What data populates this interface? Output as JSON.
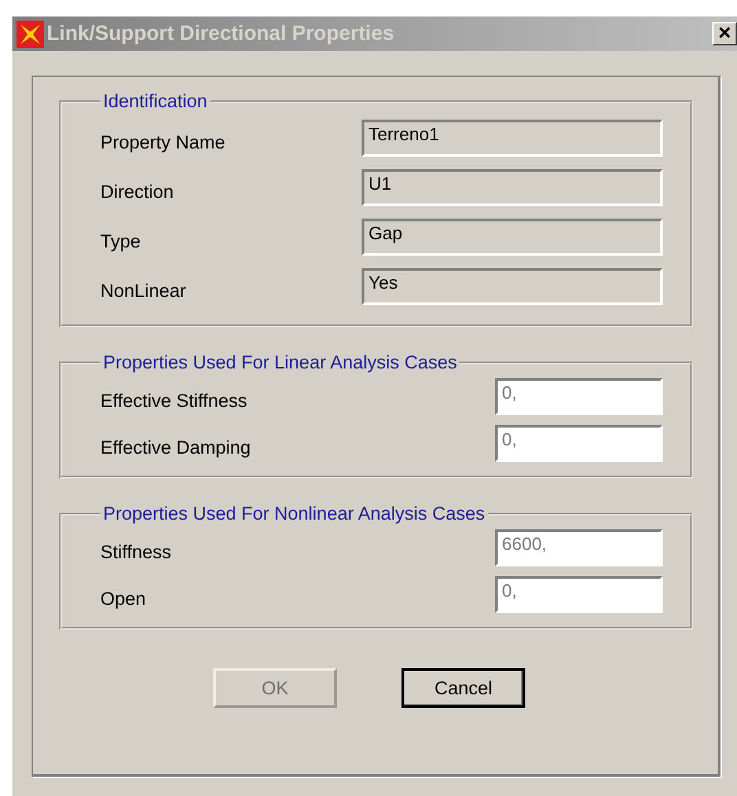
{
  "window": {
    "title": "Link/Support Directional Properties",
    "close": "×"
  },
  "groups": [
    {
      "title": "Identification",
      "kind": "identification",
      "fields": [
        {
          "label": "Property Name",
          "value": "Terreno1",
          "kind": "display",
          "disabled": false
        },
        {
          "label": "Direction",
          "value": "U1",
          "kind": "display",
          "disabled": false
        },
        {
          "label": "Type",
          "value": "Gap",
          "kind": "display",
          "disabled": false
        },
        {
          "label": "NonLinear",
          "value": "Yes",
          "kind": "display",
          "disabled": false
        }
      ]
    },
    {
      "title": "Properties Used For Linear Analysis Cases",
      "kind": "analysis",
      "fields": [
        {
          "label": "Effective Stiffness",
          "value": "0,",
          "kind": "entry",
          "disabled": true
        },
        {
          "label": "Effective Damping",
          "value": "0,",
          "kind": "entry",
          "disabled": true
        }
      ]
    },
    {
      "title": "Properties Used For Nonlinear Analysis Cases",
      "kind": "analysis",
      "fields": [
        {
          "label": "Stiffness",
          "value": "6600,",
          "kind": "entry",
          "disabled": true
        },
        {
          "label": "Open",
          "value": "0,",
          "kind": "entry",
          "disabled": true
        }
      ]
    }
  ],
  "buttons": [
    {
      "label": "OK",
      "disabled": true,
      "default": false
    },
    {
      "label": "Cancel",
      "disabled": false,
      "default": true
    }
  ]
}
